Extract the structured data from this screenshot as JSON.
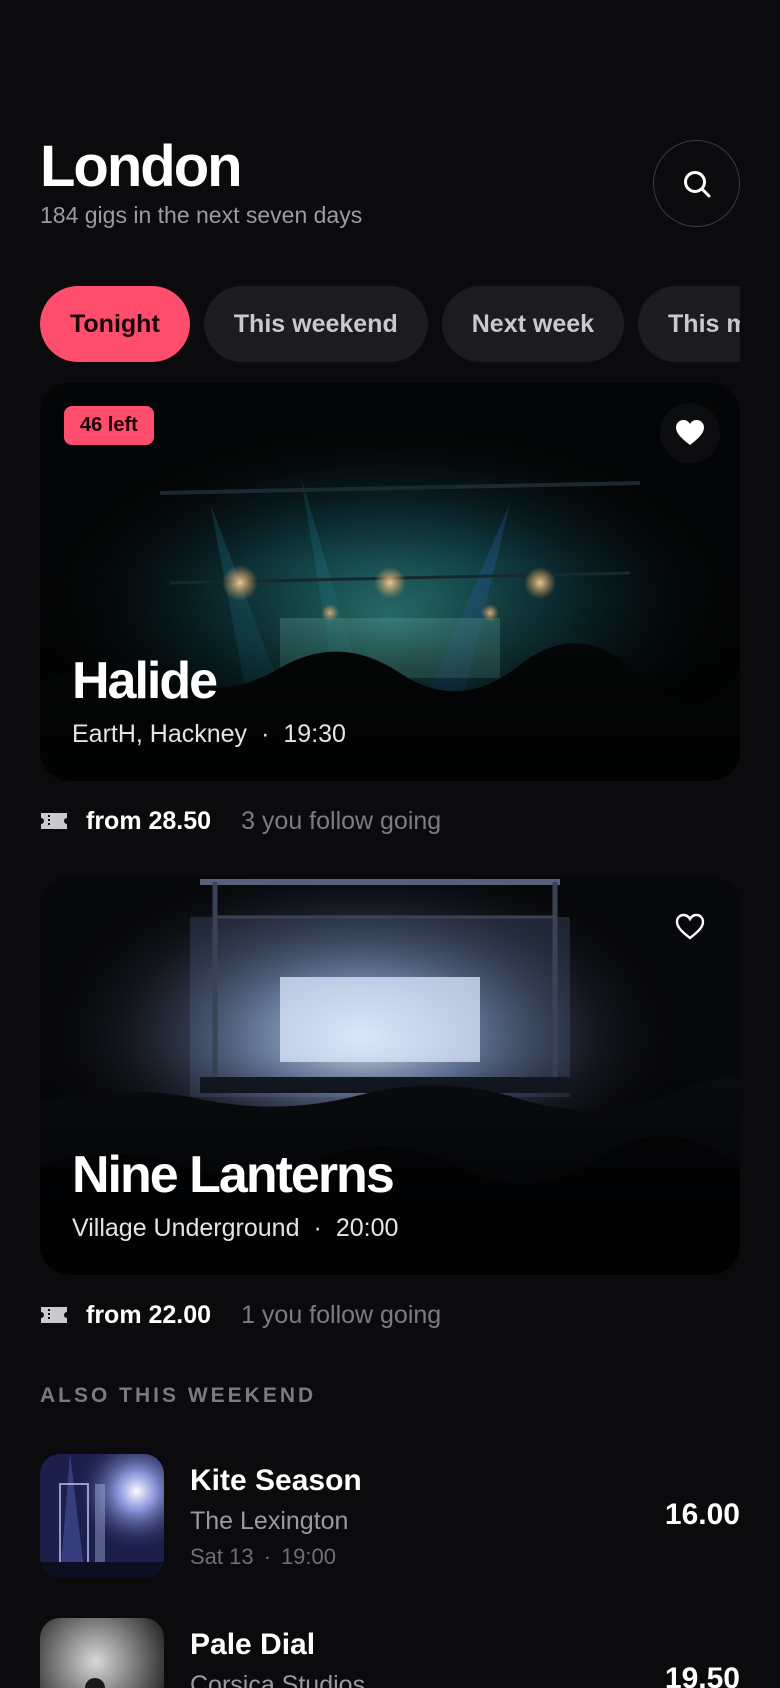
{
  "header": {
    "city": "London",
    "subtitle": "184 gigs in the next seven days"
  },
  "filters": [
    {
      "label": "Tonight",
      "active": true
    },
    {
      "label": "This weekend",
      "active": false
    },
    {
      "label": "Next week",
      "active": false
    },
    {
      "label": "This month",
      "active": false
    }
  ],
  "events": [
    {
      "title": "Halide",
      "venue": "EartH, Hackney",
      "separator": "·",
      "time": "19:30",
      "badge": "46 left",
      "favourite": true,
      "price": "from 28.50",
      "follow": "3 you follow going"
    },
    {
      "title": "Nine Lanterns",
      "venue": "Village Underground",
      "separator": "·",
      "time": "20:00",
      "favourite": false,
      "price": "from 22.00",
      "follow": "1 you follow going"
    }
  ],
  "section": {
    "label": "ALSO THIS WEEKEND"
  },
  "list": [
    {
      "title": "Kite Season",
      "venue": "The Lexington",
      "day": "Sat 13",
      "separator": "·",
      "time": "19:00",
      "price": "16.00"
    },
    {
      "title": "Pale Dial",
      "venue": "Corsica Studios",
      "price": "19.50"
    }
  ],
  "icons": {
    "search": "search-icon",
    "heart": "heart-icon",
    "ticket": "ticket-icon"
  },
  "colors": {
    "background": "#0b0b0d",
    "accent": "#ff4d6d",
    "chip": "#1c1c20",
    "muted": "#7c7c83"
  }
}
